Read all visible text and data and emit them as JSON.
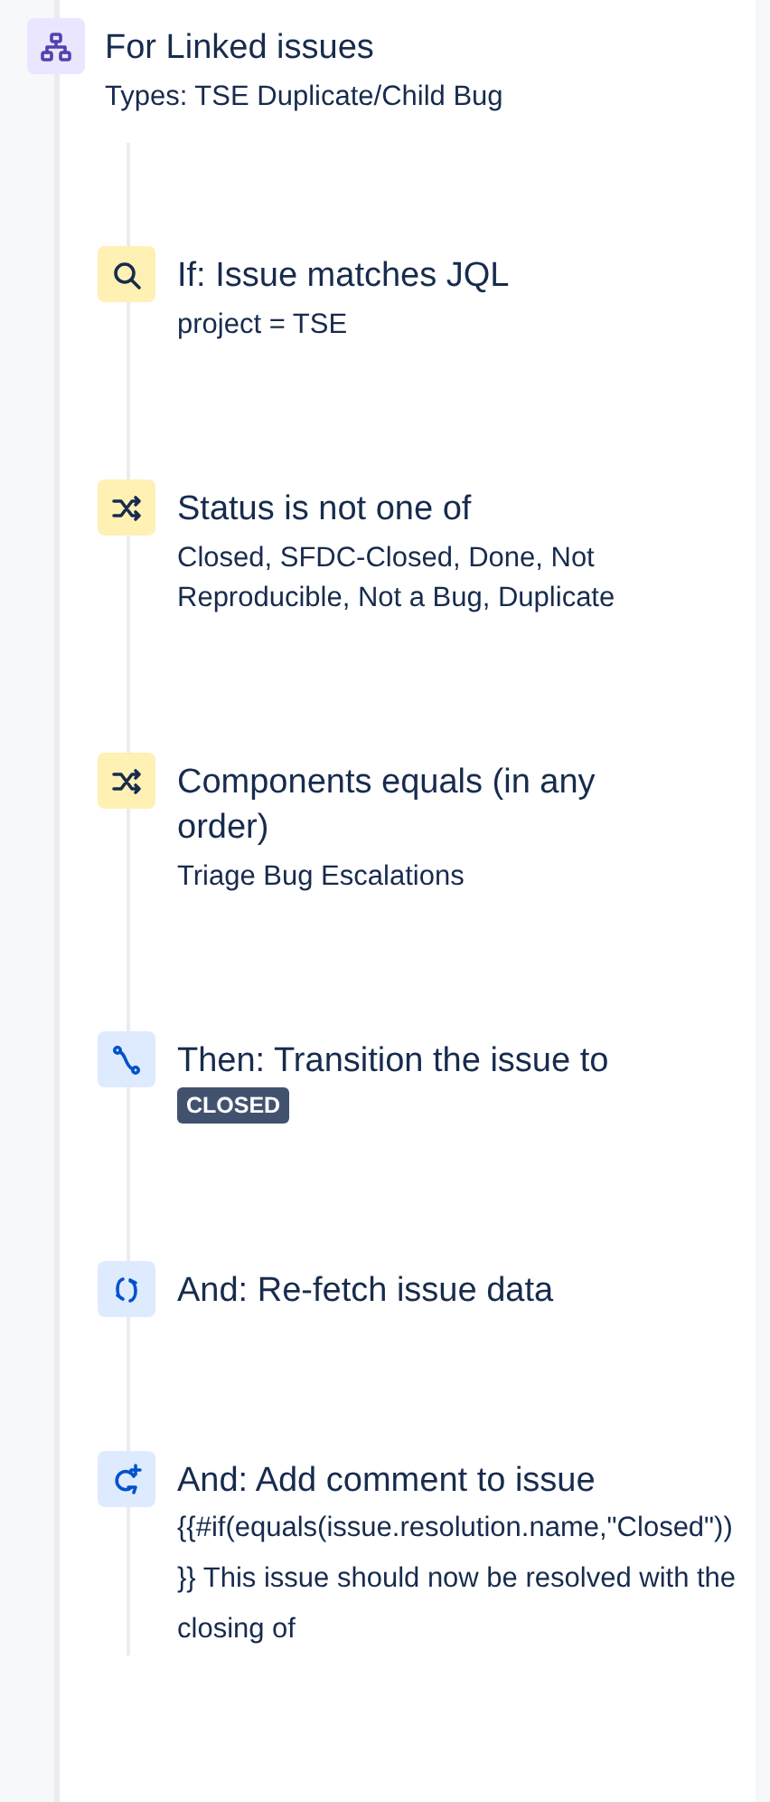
{
  "branch": {
    "kind": "branch",
    "color": "#eae6ff",
    "title": "For Linked issues",
    "subtitle": "Types: TSE Duplicate/Child Bug",
    "children": [
      {
        "kind": "search",
        "color": "#fff0b3",
        "title": "If: Issue matches JQL",
        "subtitle": "project = TSE"
      },
      {
        "kind": "shuffle",
        "color": "#fff0b3",
        "title": "Status is not one of",
        "subtitle": "Closed, SFDC-Closed, Done, Not Reproducible, Not a Bug, Duplicate"
      },
      {
        "kind": "shuffle",
        "color": "#fff0b3",
        "title": "Components equals (in any order)",
        "subtitle": "Triage Bug Escalations"
      },
      {
        "kind": "transition",
        "color": "#deebff",
        "title": "Then: Transition the issue to",
        "lozenge": "CLOSED"
      },
      {
        "kind": "refetch",
        "color": "#deebff",
        "title": "And: Re-fetch issue data"
      },
      {
        "kind": "comment",
        "color": "#deebff",
        "title": "And: Add comment to issue",
        "description": "{{#if(equals(issue.resolution.name,\"Closed\"))}} This issue should now be resolved with the closing of"
      }
    ]
  }
}
